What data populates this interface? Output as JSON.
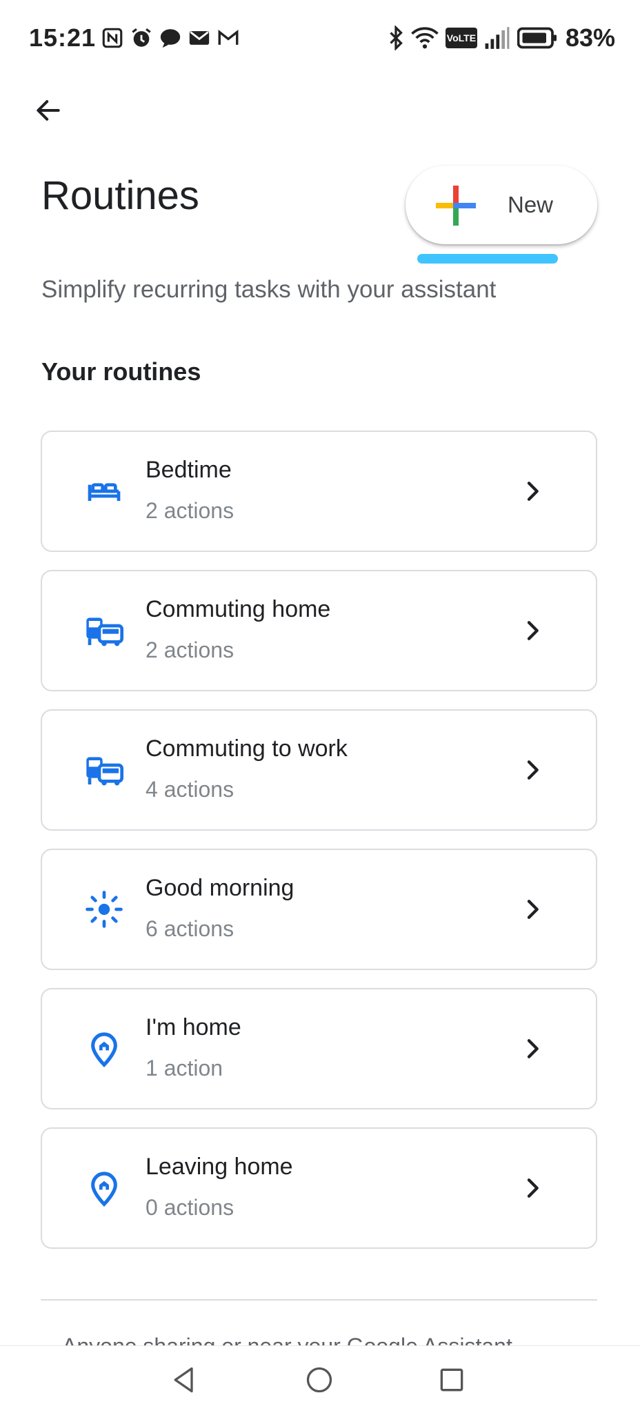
{
  "status_bar": {
    "time": "15:21",
    "left_icons": [
      "nfc-icon",
      "alarm-icon",
      "chat-icon",
      "mail-icon",
      "gmail-icon"
    ],
    "right_icons": [
      "bluetooth-icon",
      "wifi-icon",
      "volte-icon",
      "signal-icon",
      "battery-icon"
    ],
    "volte_label": "VoLTE",
    "battery": "83%"
  },
  "header": {
    "title": "Routines",
    "new_button_label": "New",
    "subtitle": "Simplify recurring tasks with your assistant"
  },
  "section": {
    "heading": "Your routines"
  },
  "routines": [
    {
      "name": "Bedtime",
      "count": "2 actions",
      "icon": "bed-icon"
    },
    {
      "name": "Commuting home",
      "count": "2 actions",
      "icon": "commute-icon"
    },
    {
      "name": "Commuting to work",
      "count": "4 actions",
      "icon": "commute-icon"
    },
    {
      "name": "Good morning",
      "count": "6 actions",
      "icon": "sun-icon"
    },
    {
      "name": "I'm home",
      "count": "1 action",
      "icon": "home-pin-icon"
    },
    {
      "name": "Leaving home",
      "count": "0 actions",
      "icon": "home-pin-icon"
    }
  ],
  "footer": {
    "text": "Anyone sharing or near your Google Assistant"
  },
  "colors": {
    "accent_blue": "#1a73e8",
    "underline": "#40c4ff",
    "google_red": "#ea4335",
    "google_blue": "#4285f4",
    "google_green": "#34a853",
    "google_yellow": "#fbbc04"
  }
}
